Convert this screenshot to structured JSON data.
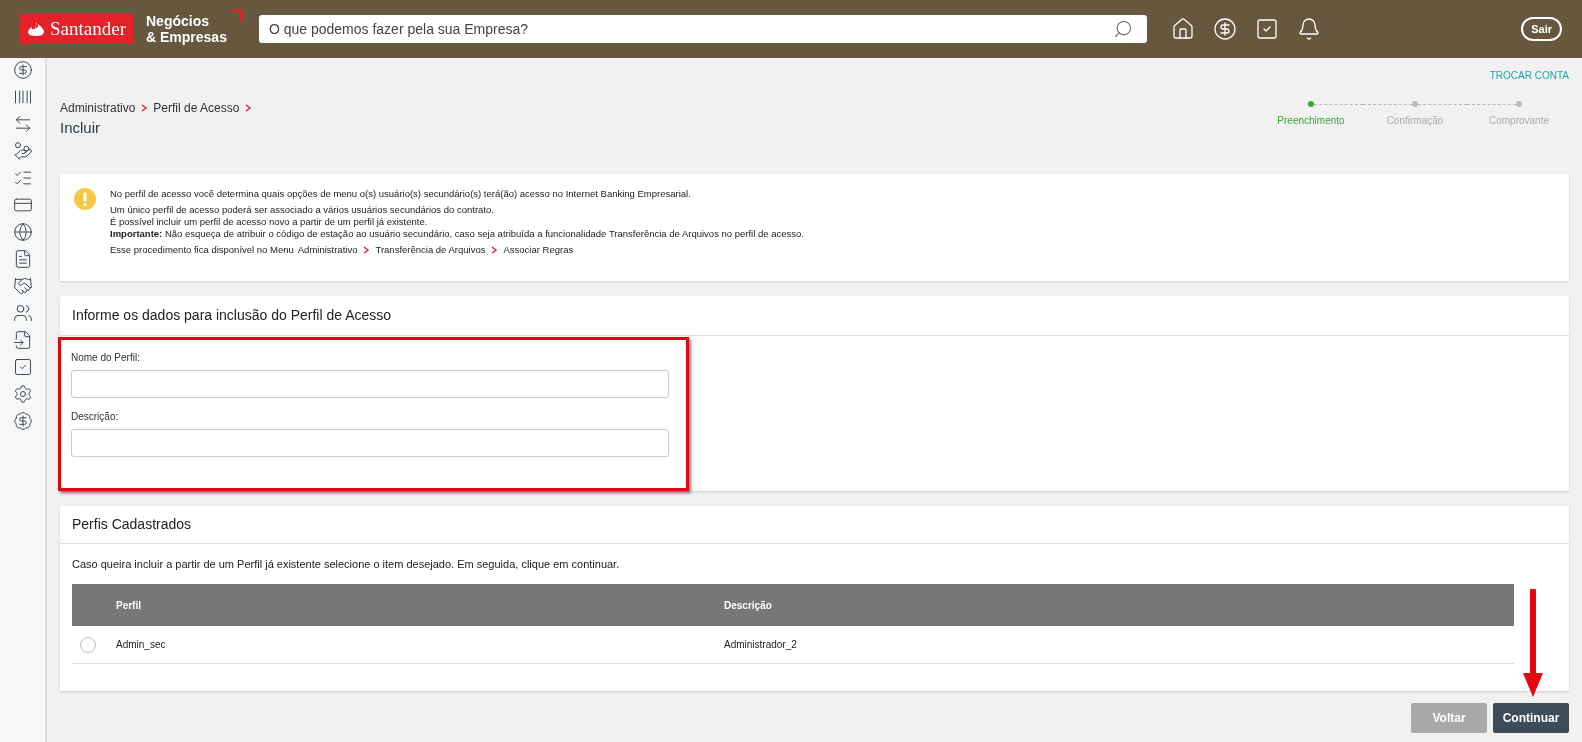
{
  "header": {
    "brand": "Santander",
    "product_line1": "Negócios",
    "product_line2": "& Empresas",
    "search": {
      "placeholder": "O que podemos fazer pela sua Empresa?"
    },
    "logout": "Sair"
  },
  "sidebar": {
    "items": [
      {
        "kind": "dollar-cycle"
      },
      {
        "kind": "barcode"
      },
      {
        "kind": "transfer"
      },
      {
        "kind": "hand-coins"
      },
      {
        "kind": "list"
      },
      {
        "kind": "card"
      },
      {
        "kind": "globe"
      },
      {
        "kind": "document"
      },
      {
        "kind": "handshake"
      },
      {
        "kind": "people"
      },
      {
        "kind": "doc-arrow"
      },
      {
        "kind": "check"
      },
      {
        "kind": "gear"
      },
      {
        "kind": "dollar-plus"
      }
    ]
  },
  "switch_account": "TROCAR CONTA",
  "breadcrumb": [
    "Administrativo",
    "Perfil de Acesso"
  ],
  "page_title": "Incluir",
  "steps": [
    {
      "label": "Preenchimento",
      "selected": true
    },
    {
      "label": "Confirmação",
      "selected": false
    },
    {
      "label": "Comprovante",
      "selected": false
    }
  ],
  "notice": {
    "lead": "No perfil de acesso você determina quais opções de menu o(s) usuário(s) secundário(s) terá(ão) acesso no Internet Banking Empresarial.",
    "lines": [
      "Um único perfil de acesso poderá ser associado a vários usuários secundários do contrato.",
      "É possível incluir um perfil de acesso novo a partir de um perfil já existente.",
      "**Importante:** Não esqueça de atribuir o código de estação ao usuário secundário, caso seja atribuída a funcionalidade Transferência de Arquivos no perfil de acesso."
    ],
    "path_intro": "Esse procedimento fica disponível no Menu",
    "path": [
      "Administrativo",
      "Transferência de Arquivos",
      "Associar Regras"
    ]
  },
  "form": {
    "title": "Informe os dados para inclusão do Perfil de Acesso",
    "fields": [
      {
        "label": "Nome do Perfil:"
      },
      {
        "label": "Descrição:"
      }
    ]
  },
  "profiles": {
    "title": "Perfis Cadastrados",
    "hint": "Caso queira incluir a partir de um Perfil já existente selecione o item desejado. Em seguida, clique em continuar.",
    "columns": [
      "Perfil",
      "Descrição"
    ],
    "rows": [
      {
        "cells": [
          "Admin_sec",
          "Administrador_2"
        ],
        "selected": false
      }
    ]
  },
  "buttons": [
    {
      "label": "Voltar",
      "kind": "secondary"
    },
    {
      "label": "Continuar",
      "kind": "primary"
    }
  ]
}
